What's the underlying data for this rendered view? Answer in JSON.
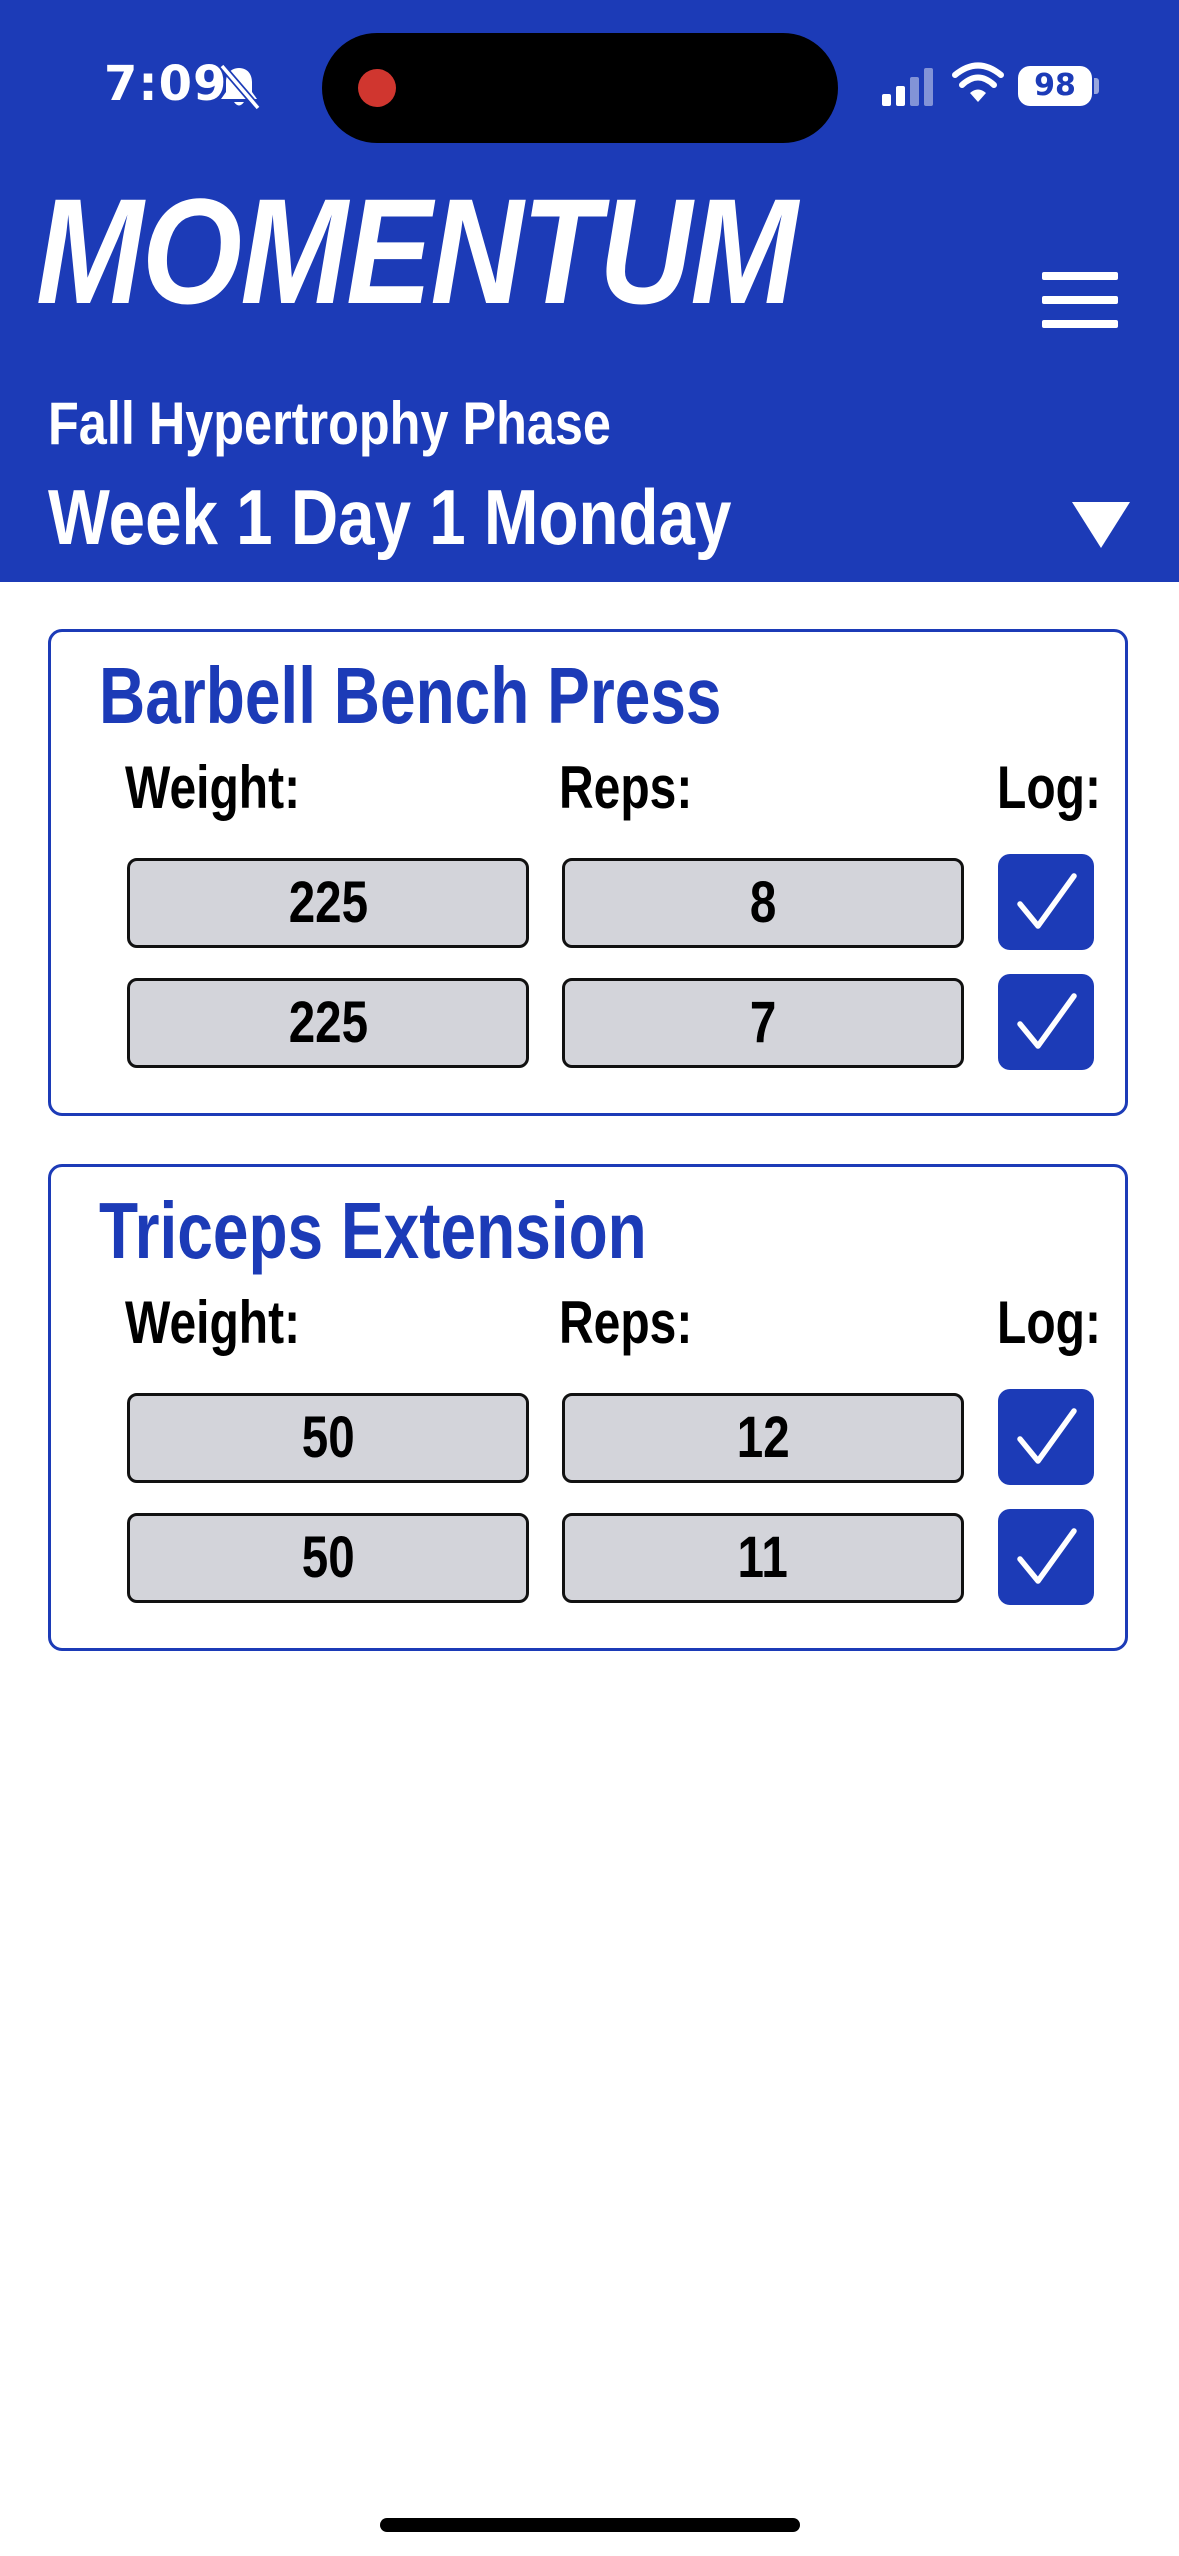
{
  "status_bar": {
    "time": "7:09",
    "battery": "98",
    "icons": [
      "bell-slash-icon",
      "signal-icon",
      "wifi-icon",
      "battery-icon"
    ]
  },
  "header": {
    "app_title": "MOMENTUM",
    "phase": "Fall Hypertrophy Phase",
    "day": "Week 1 Day 1 Monday",
    "menu_icon": "hamburger-menu-icon",
    "dropdown_icon": "triangle-down-icon"
  },
  "columns": {
    "weight": "Weight:",
    "reps": "Reps:",
    "log": "Log:"
  },
  "exercises": [
    {
      "name": "Barbell Bench Press",
      "sets": [
        {
          "weight": "225",
          "reps": "8",
          "logged": true
        },
        {
          "weight": "225",
          "reps": "7",
          "logged": true
        }
      ]
    },
    {
      "name": "Triceps Extension",
      "sets": [
        {
          "weight": "50",
          "reps": "12",
          "logged": true
        },
        {
          "weight": "50",
          "reps": "11",
          "logged": true
        }
      ]
    }
  ],
  "colors": {
    "primary": "#1c3bb7",
    "field_bg": "#d3d4da",
    "record_dot": "#d0362f"
  }
}
